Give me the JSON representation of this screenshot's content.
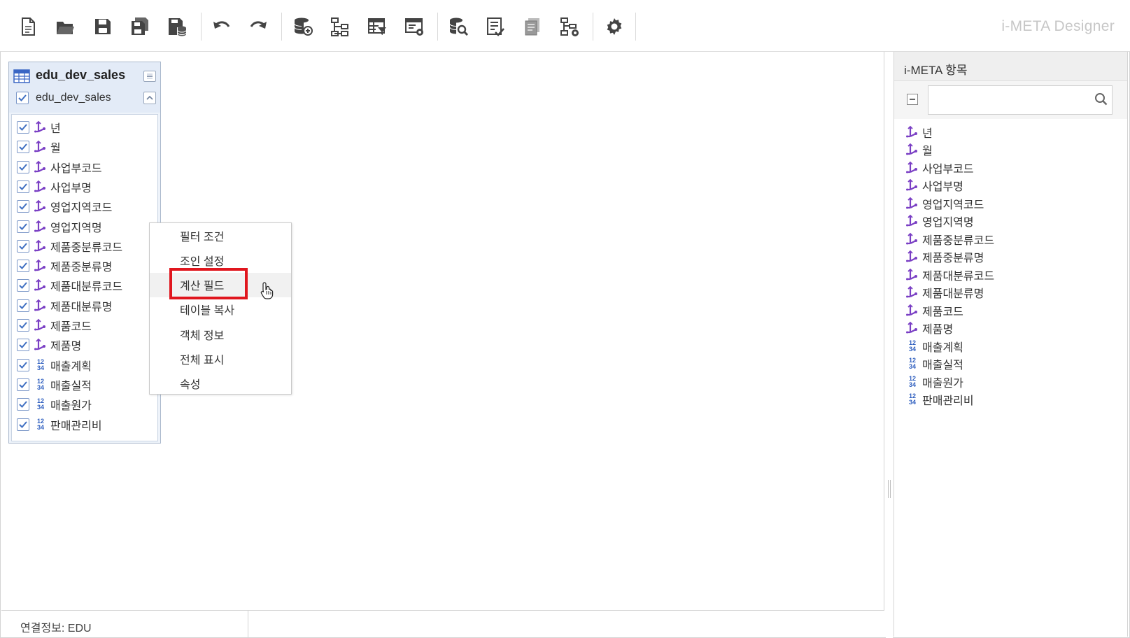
{
  "app": {
    "title": "i-META Designer"
  },
  "toolbar": {
    "buttons": [
      {
        "name": "new-file",
        "icon": "new-document-icon"
      },
      {
        "name": "open",
        "icon": "folder-open-icon"
      },
      {
        "name": "save",
        "icon": "save-icon"
      },
      {
        "name": "save-as",
        "icon": "save-as-icon"
      },
      {
        "name": "save-db",
        "icon": "save-database-icon"
      },
      {
        "name": "undo",
        "icon": "undo-icon"
      },
      {
        "name": "redo",
        "icon": "redo-icon"
      },
      {
        "name": "db-connect",
        "icon": "database-link-icon"
      },
      {
        "name": "hierarchy",
        "icon": "hierarchy-icon"
      },
      {
        "name": "table-filter",
        "icon": "table-filter-icon"
      },
      {
        "name": "window-settings",
        "icon": "window-gear-icon"
      },
      {
        "name": "db-search",
        "icon": "database-search-icon"
      },
      {
        "name": "checklist",
        "icon": "checklist-icon"
      },
      {
        "name": "document",
        "icon": "document-stack-icon"
      },
      {
        "name": "tree-settings",
        "icon": "tree-gear-icon"
      },
      {
        "name": "settings",
        "icon": "gear-icon"
      }
    ]
  },
  "table": {
    "title": "edu_dev_sales",
    "subtitle": "edu_dev_sales",
    "fields": [
      {
        "label": "년",
        "type": "dimension"
      },
      {
        "label": "월",
        "type": "dimension"
      },
      {
        "label": "사업부코드",
        "type": "dimension"
      },
      {
        "label": "사업부명",
        "type": "dimension"
      },
      {
        "label": "영업지역코드",
        "type": "dimension"
      },
      {
        "label": "영업지역명",
        "type": "dimension"
      },
      {
        "label": "제품중분류코드",
        "type": "dimension"
      },
      {
        "label": "제품중분류명",
        "type": "dimension"
      },
      {
        "label": "제품대분류코드",
        "type": "dimension"
      },
      {
        "label": "제품대분류명",
        "type": "dimension"
      },
      {
        "label": "제품코드",
        "type": "dimension"
      },
      {
        "label": "제품명",
        "type": "dimension"
      },
      {
        "label": "매출계획",
        "type": "measure"
      },
      {
        "label": "매출실적",
        "type": "measure"
      },
      {
        "label": "매출원가",
        "type": "measure"
      },
      {
        "label": "판매관리비",
        "type": "measure"
      }
    ]
  },
  "context_menu": {
    "items": [
      {
        "label": "필터 조건"
      },
      {
        "label": "조인 설정"
      },
      {
        "label": "계산 필드",
        "highlighted": true
      },
      {
        "label": "테이블 복사"
      },
      {
        "label": "객체 정보"
      },
      {
        "label": "전체 표시"
      },
      {
        "label": "속성"
      }
    ]
  },
  "status": {
    "connection": "연결정보: EDU"
  },
  "right_panel": {
    "title": "i-META 항목",
    "search": {
      "value": "",
      "placeholder": ""
    },
    "items": [
      {
        "label": "년",
        "type": "dimension"
      },
      {
        "label": "월",
        "type": "dimension"
      },
      {
        "label": "사업부코드",
        "type": "dimension"
      },
      {
        "label": "사업부명",
        "type": "dimension"
      },
      {
        "label": "영업지역코드",
        "type": "dimension"
      },
      {
        "label": "영업지역명",
        "type": "dimension"
      },
      {
        "label": "제품중분류코드",
        "type": "dimension"
      },
      {
        "label": "제품중분류명",
        "type": "dimension"
      },
      {
        "label": "제품대분류코드",
        "type": "dimension"
      },
      {
        "label": "제품대분류명",
        "type": "dimension"
      },
      {
        "label": "제품코드",
        "type": "dimension"
      },
      {
        "label": "제품명",
        "type": "dimension"
      },
      {
        "label": "매출계획",
        "type": "measure"
      },
      {
        "label": "매출실적",
        "type": "measure"
      },
      {
        "label": "매출원가",
        "type": "measure"
      },
      {
        "label": "판매관리비",
        "type": "measure"
      }
    ]
  },
  "colors": {
    "dimension_icon": "#7a3fc4",
    "measure_icon": "#2f5fbf",
    "highlight_box": "#e0161e",
    "checkbox_check": "#3f6fc2"
  }
}
